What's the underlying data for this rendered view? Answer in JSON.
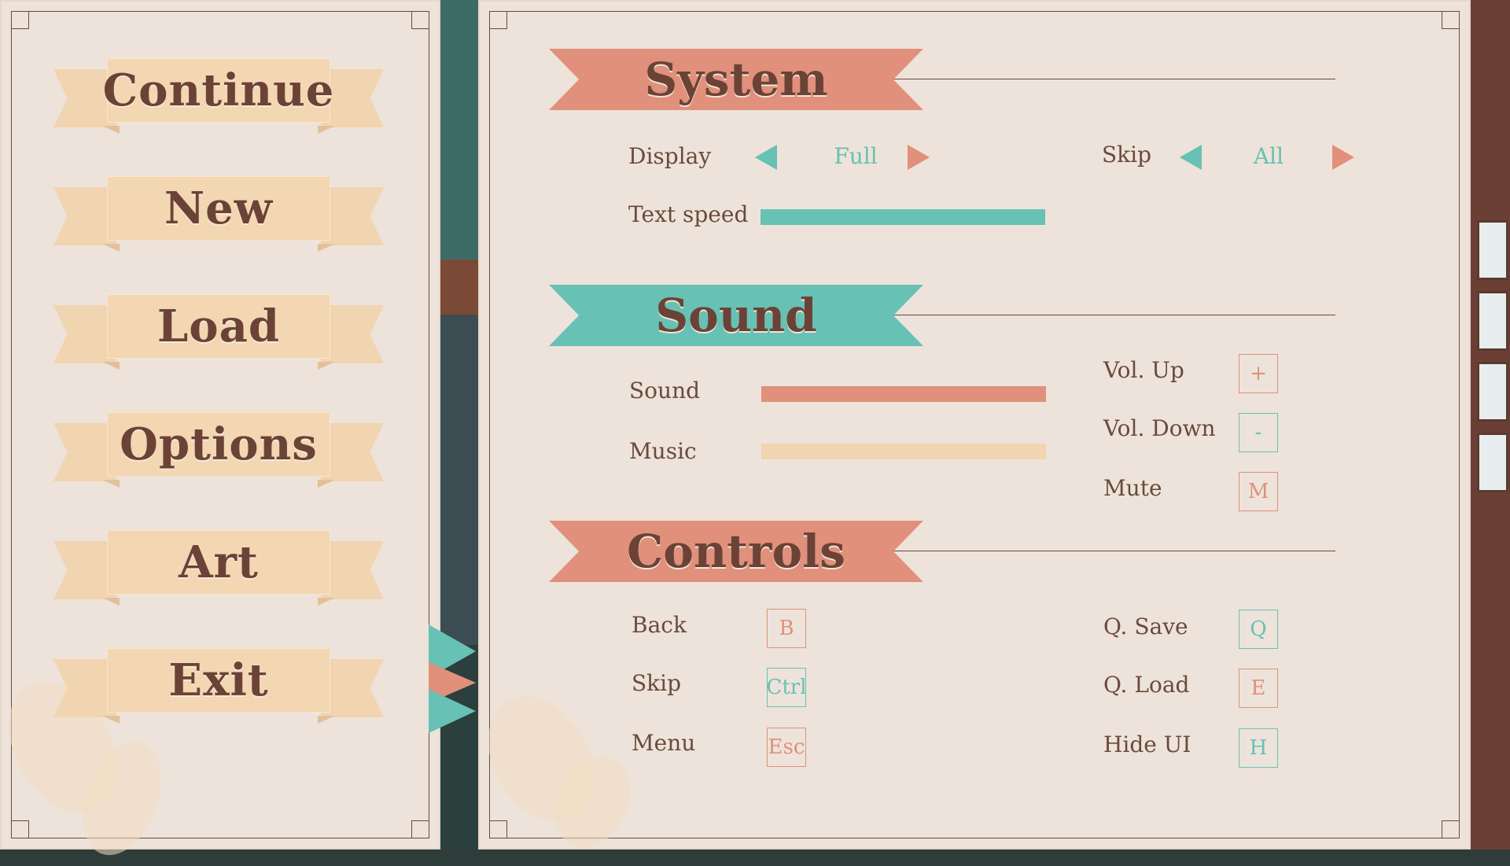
{
  "colors": {
    "salmon": "#e0907b",
    "teal": "#67c1b4",
    "peach": "#f1d4b0",
    "text": "#6a4a3c"
  },
  "menu": {
    "items": [
      {
        "label": "Continue"
      },
      {
        "label": "New"
      },
      {
        "label": "Load"
      },
      {
        "label": "Options"
      },
      {
        "label": "Art"
      },
      {
        "label": "Exit"
      }
    ]
  },
  "system": {
    "title": "System",
    "display_label": "Display",
    "display_value": "Full",
    "skip_label": "Skip",
    "skip_value": "All",
    "text_speed_label": "Text speed",
    "text_speed_level": 1.0
  },
  "sound": {
    "title": "Sound",
    "sound_label": "Sound",
    "sound_level": 1.0,
    "music_label": "Music",
    "music_level": 1.0,
    "vol_up_label": "Vol. Up",
    "vol_up_key": "+",
    "vol_down_label": "Vol. Down",
    "vol_down_key": "-",
    "mute_label": "Mute",
    "mute_key": "M"
  },
  "controls": {
    "title": "Controls",
    "back_label": "Back",
    "back_key": "B",
    "skip_label": "Skip",
    "skip_key": "Ctrl",
    "menu_label": "Menu",
    "menu_key": "Esc",
    "qsave_label": "Q. Save",
    "qsave_key": "Q",
    "qload_label": "Q. Load",
    "qload_key": "E",
    "hideui_label": "Hide UI",
    "hideui_key": "H"
  }
}
